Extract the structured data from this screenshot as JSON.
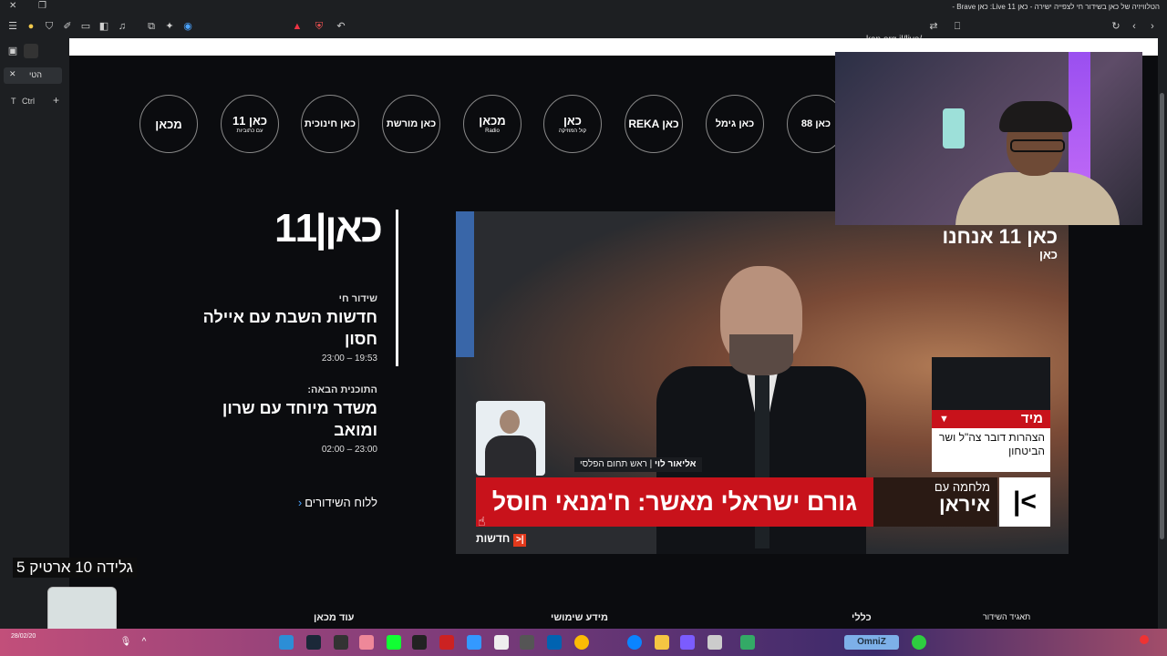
{
  "window": {
    "title": "הטלוויזיה של כאן בשידור חי לצפייה ישירה - כאן 11 Live: כאן Brave -",
    "url": "kan.org.il/live/"
  },
  "sidebar": {
    "tab_label": "הטי",
    "ctrl_label": "Ctrl",
    "t_label": "T"
  },
  "channels": [
    {
      "name": "כאן 11",
      "sub": "עם כתוביות"
    },
    {
      "name": "מכאן",
      "sub": ""
    },
    {
      "name": "כאן חינוכית",
      "sub": ""
    },
    {
      "name": "כאן מורשת",
      "sub": ""
    },
    {
      "name": "מכאן",
      "sub": "Radio"
    },
    {
      "name": "כאן",
      "sub": "קול המוזיקה"
    },
    {
      "name": "REKA כאן",
      "sub": ""
    },
    {
      "name": "כאן גימל",
      "sub": ""
    },
    {
      "name": "כאן 88",
      "sub": ""
    }
  ],
  "live": {
    "logo": "כאן|11",
    "live_label": "שידור חי",
    "show_title": "חדשות השבת עם איילה חסון",
    "show_time": "19:53 – 23:00",
    "next_label": "התוכנית הבאה:",
    "next_title": "משדר מיוחד עם שרון ומואב",
    "next_time": "23:00 – 02:00",
    "schedule_link": "ללוח השידורים"
  },
  "video": {
    "corner_logo_top": "כאן 11 אנחנו",
    "corner_logo_bottom": "כאן",
    "urgent_header": "מיד",
    "urgent_body": "הצהרות דובר צה\"ל ושר הביטחון",
    "speaker_name": "אליאור לוי",
    "speaker_role": "ראש תחום הפלסי",
    "headline": "גורם ישראלי מאשר: ח'מנאי חוסל",
    "war_line1": "מלחמה עם",
    "war_line2": "איראן",
    "news_label": "חדשות"
  },
  "footer": [
    "עוד מכאן",
    "מידע שימושי",
    "כללי",
    "תאגיד השידור"
  ],
  "overlay": {
    "caption": "גלידה 10 ארטיק 5"
  },
  "taskbar": {
    "date": "28/02/20",
    "weather_label": "OmniZ"
  }
}
